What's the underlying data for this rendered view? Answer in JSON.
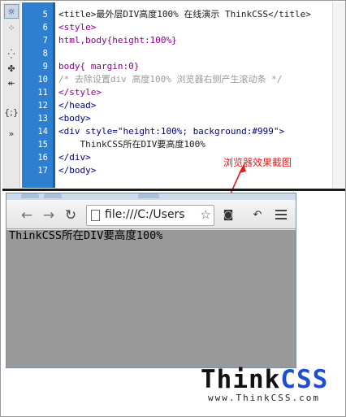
{
  "editor": {
    "tools": [
      "☼",
      "⁘",
      "⁛",
      "✤",
      "↞",
      "{;}",
      "»"
    ],
    "lines": [
      {
        "no": "5",
        "parts": [
          {
            "t": "<title>最外层DIV高度100% 在线演示 ThinkCSS</title>",
            "c": "c-dark"
          }
        ]
      },
      {
        "no": "6",
        "parts": [
          {
            "t": "<style>",
            "c": "c-purple"
          }
        ]
      },
      {
        "no": "7",
        "parts": [
          {
            "t": "html,body{height:100%}",
            "c": "c-purple"
          }
        ]
      },
      {
        "no": "8",
        "parts": [
          {
            "t": "",
            "c": "c-dark"
          }
        ]
      },
      {
        "no": "9",
        "parts": [
          {
            "t": "body{ margin:0}",
            "c": "c-purple"
          }
        ]
      },
      {
        "no": "10",
        "parts": [
          {
            "t": "/* 去除设置div 高度100% 浏览器右侧产生滚动条 */",
            "c": "c-gray"
          }
        ]
      },
      {
        "no": "11",
        "parts": [
          {
            "t": "</style>",
            "c": "c-purple"
          }
        ]
      },
      {
        "no": "12",
        "parts": [
          {
            "t": "</head>",
            "c": "c-navy"
          }
        ]
      },
      {
        "no": "13",
        "parts": [
          {
            "t": "<body>",
            "c": "c-navy"
          }
        ]
      },
      {
        "no": "14",
        "parts": [
          {
            "t": "<div style=\"height:100%; background:#999\">",
            "c": "c-navy"
          }
        ]
      },
      {
        "no": "15",
        "parts": [
          {
            "t": "    ThinkCSS所在DIV要高度100%",
            "c": "c-dark"
          }
        ]
      },
      {
        "no": "16",
        "parts": [
          {
            "t": "</div>",
            "c": "c-navy"
          }
        ]
      },
      {
        "no": "17",
        "parts": [
          {
            "t": "</body>",
            "c": "c-navy"
          }
        ]
      }
    ]
  },
  "annotation": {
    "label": "浏览器效果截图",
    "color": "#e02020"
  },
  "browser": {
    "back_icon": "←",
    "forward_icon": "→",
    "reload_icon": "↻",
    "url": "file:///C:/Users",
    "star_icon": "☆",
    "ext1_icon": "◙",
    "ext2_icon": "↶",
    "page_text": "ThinkCSS所在DIV要高度100%",
    "page_background": "#999999"
  },
  "watermark": {
    "part1": "Think",
    "part2": "CSS",
    "url": "www.ThinkCSS.com",
    "accent": "#1f4fd0"
  }
}
